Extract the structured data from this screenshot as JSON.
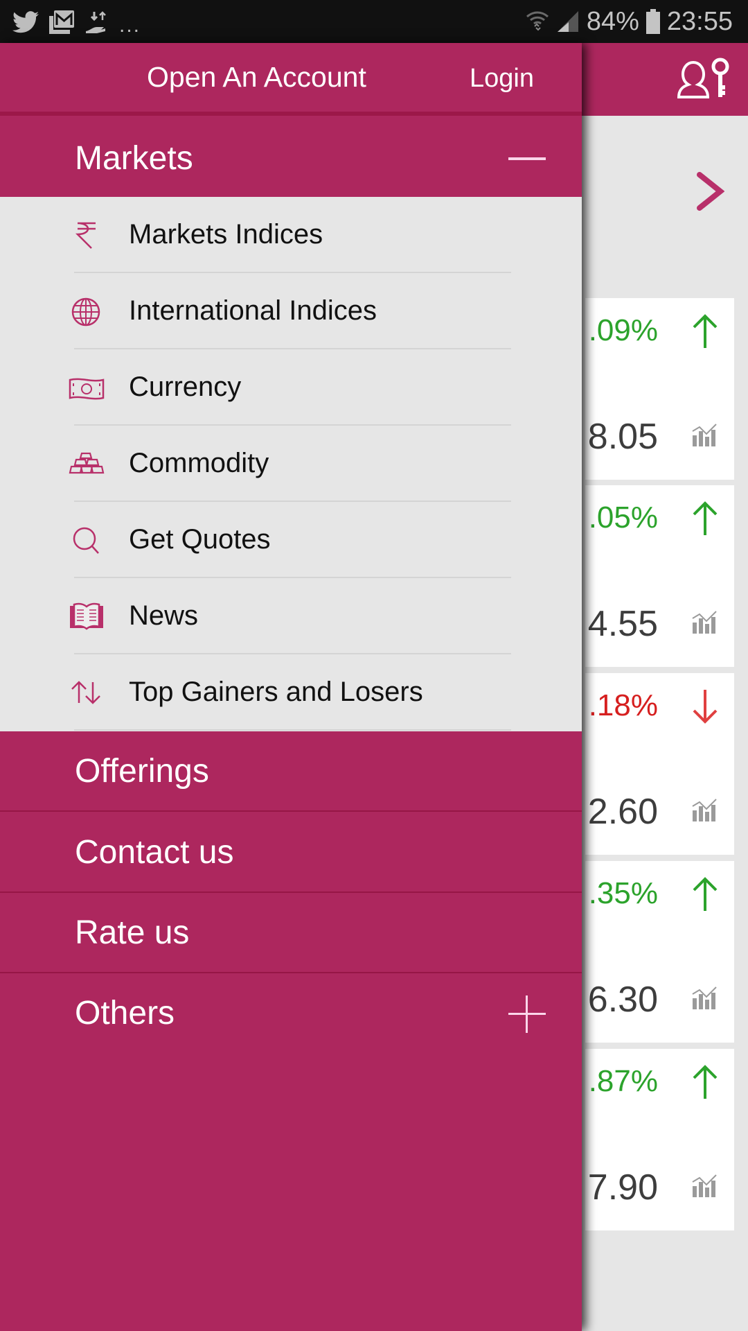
{
  "status_bar": {
    "notification_icons": [
      "twitter-icon",
      "gmail-icon",
      "data-transfer-icon"
    ],
    "overflow": "...",
    "battery_percent": "84%",
    "time": "23:55",
    "system_icons": [
      "wifi-icon",
      "signal-icon",
      "battery-icon"
    ]
  },
  "drawer": {
    "header": {
      "open_account_label": "Open An Account",
      "login_label": "Login"
    },
    "markets": {
      "label": "Markets",
      "expanded": true,
      "items": [
        {
          "label": "Markets Indices",
          "icon": "rupee-icon"
        },
        {
          "label": "International Indices",
          "icon": "globe-icon"
        },
        {
          "label": "Currency",
          "icon": "banknote-icon"
        },
        {
          "label": "Commodity",
          "icon": "gold-bars-icon"
        },
        {
          "label": "Get Quotes",
          "icon": "search-icon"
        },
        {
          "label": "News",
          "icon": "open-book-icon"
        },
        {
          "label": "Top Gainers and Losers",
          "icon": "up-down-arrows-icon"
        }
      ]
    },
    "main_items": [
      {
        "label": "Offerings"
      },
      {
        "label": "Contact us"
      },
      {
        "label": "Rate us"
      },
      {
        "label": "Others",
        "expandable": true
      }
    ]
  },
  "background": {
    "cards": [
      {
        "change": ".09%",
        "direction": "up",
        "price": "8.05"
      },
      {
        "change": ".05%",
        "direction": "up",
        "price": "4.55"
      },
      {
        "change": ".18%",
        "direction": "down",
        "price": "2.60"
      },
      {
        "change": ".35%",
        "direction": "up",
        "price": "6.30"
      },
      {
        "change": ".87%",
        "direction": "up",
        "price": "7.90"
      }
    ]
  },
  "colors": {
    "brand": "#ad275e",
    "brand_dark": "#9c1849",
    "positive": "#2ca32c",
    "negative": "#d61f1f",
    "submenu_bg": "#e6e6e6"
  }
}
